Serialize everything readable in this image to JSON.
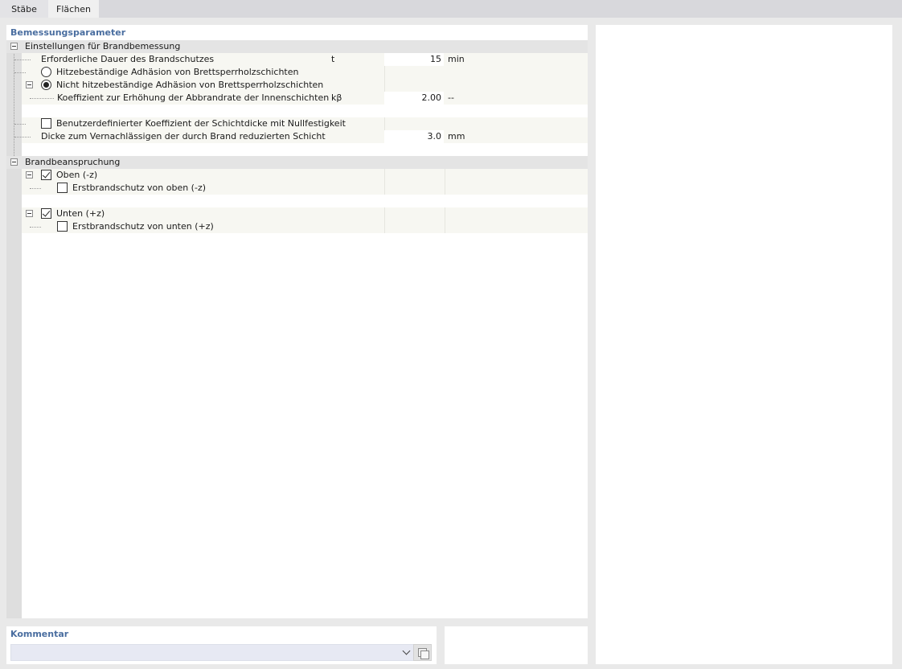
{
  "tabs": [
    {
      "label": "Stäbe"
    },
    {
      "label": "Flächen"
    }
  ],
  "main": {
    "header": "Bemessungsparameter",
    "sections": {
      "fire_design": {
        "title": "Einstellungen für Brandbemessung",
        "duration": {
          "label": "Erforderliche Dauer des Brandschutzes",
          "symbol": "t",
          "value": "15",
          "unit": "min"
        },
        "opt_heat_resistant": {
          "label": "Hitzebeständige Adhäsion von Brettsperrholzschichten",
          "selected": false
        },
        "opt_non_heat_resistant": {
          "label": "Nicht hitzebeständige Adhäsion von Brettsperrholzschichten",
          "selected": true
        },
        "coefficient": {
          "label": "Koeffizient zur Erhöhung der Abbrandrate der Innenschichten",
          "symbol": "kβ",
          "value": "2.00",
          "unit": "--"
        },
        "custom_coefficient": {
          "label": "Benutzerdefinierter Koeffizient der Schichtdicke mit Nullfestigkeit",
          "checked": false
        },
        "thickness": {
          "label": "Dicke zum Vernachlässigen der durch Brand reduzierten Schicht",
          "value": "3.0",
          "unit": "mm"
        }
      },
      "fire_exposure": {
        "title": "Brandbeanspruchung",
        "top": {
          "label": "Oben (-z)",
          "checked": true
        },
        "top_initial": {
          "label": "Erstbrandschutz von oben (-z)",
          "checked": false
        },
        "bottom": {
          "label": "Unten (+z)",
          "checked": true
        },
        "bottom_initial": {
          "label": "Erstbrandschutz von unten (+z)",
          "checked": false
        }
      }
    }
  },
  "comment": {
    "header": "Kommentar",
    "value": ""
  }
}
